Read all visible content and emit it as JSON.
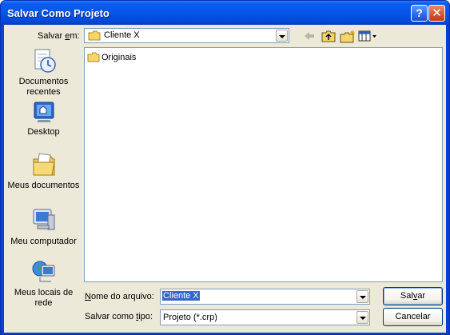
{
  "window": {
    "title": "Salvar Como Projeto"
  },
  "titlebar": {
    "help_icon": "help-question-icon",
    "close_icon": "close-x-icon"
  },
  "save_in": {
    "label_prefix": "Salvar ",
    "label_underlined": "e",
    "label_suffix": "m:",
    "value": "Cliente X"
  },
  "toolbar": {
    "back_icon": "back-arrow-icon",
    "up_icon": "folder-up-icon",
    "new_folder_icon": "new-folder-icon",
    "views_icon": "views-menu-icon"
  },
  "places": [
    {
      "label": "Documentos recentes",
      "icon": "recent-documents-icon"
    },
    {
      "label": "Desktop",
      "icon": "desktop-icon"
    },
    {
      "label": "Meus documentos",
      "icon": "my-documents-icon"
    },
    {
      "label": "Meu computador",
      "icon": "my-computer-icon"
    },
    {
      "label": "Meus locais de rede",
      "icon": "network-places-icon"
    }
  ],
  "files": [
    {
      "name": "Originais",
      "icon": "folder-icon"
    }
  ],
  "filename": {
    "label_underlined": "N",
    "label_rest": "ome do arquivo:",
    "value": "Cliente X"
  },
  "filetype": {
    "label_prefix": "Salvar como ",
    "label_underlined": "t",
    "label_suffix": "ipo:",
    "value": "Projeto (*.crp)"
  },
  "buttons": {
    "save_prefix": "Sal",
    "save_underlined": "v",
    "save_suffix": "ar",
    "cancel": "Cancelar"
  }
}
